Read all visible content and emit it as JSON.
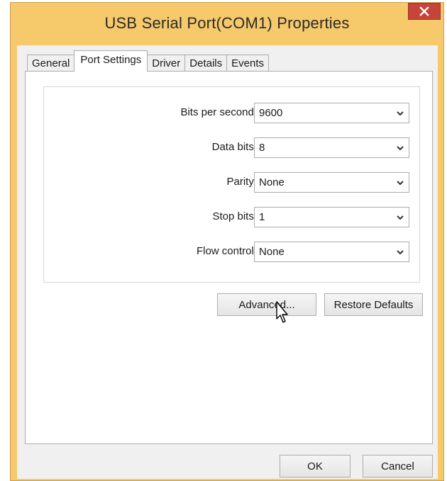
{
  "window": {
    "title": "USB Serial Port(COM1) Properties",
    "close_symbol": "✕"
  },
  "tabs": [
    {
      "label": "General",
      "active": false
    },
    {
      "label": "Port Settings",
      "active": true
    },
    {
      "label": "Driver",
      "active": false
    },
    {
      "label": "Details",
      "active": false
    },
    {
      "label": "Events",
      "active": false
    }
  ],
  "port_settings": {
    "bits_per_second": {
      "label": "Bits per second:",
      "value": "9600"
    },
    "data_bits": {
      "label": "Data bits:",
      "value": "8"
    },
    "parity": {
      "label": "Parity:",
      "value": "None"
    },
    "stop_bits": {
      "label": "Stop bits:",
      "value": "1"
    },
    "flow_control": {
      "label": "Flow control:",
      "value": "None"
    }
  },
  "buttons": {
    "advanced": "Advanced...",
    "restore_defaults": "Restore Defaults",
    "ok": "OK",
    "cancel": "Cancel"
  },
  "icons": {
    "close": "close-icon",
    "dropdown": "chevron-down-icon",
    "cursor": "mouse-pointer-icon"
  },
  "colors": {
    "title_bar": "#f6c96b",
    "close_button": "#c7443a",
    "client_bg": "#f0f0f0"
  }
}
